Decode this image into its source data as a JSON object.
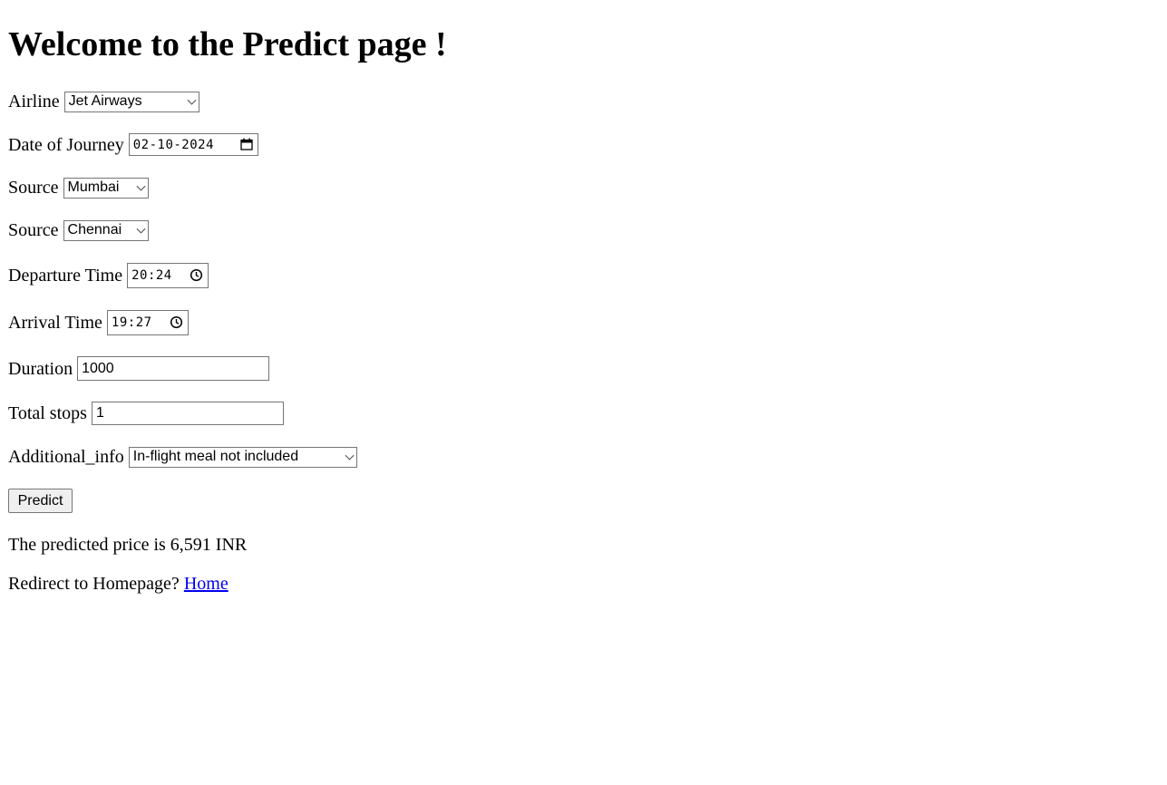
{
  "page": {
    "title": "Welcome to the Predict page !"
  },
  "form": {
    "airline": {
      "label": "Airline",
      "value": "Jet Airways"
    },
    "date_of_journey": {
      "label": "Date of Journey",
      "value": "02-10-2024"
    },
    "source": {
      "label": "Source",
      "value": "Mumbai"
    },
    "destination": {
      "label": "Source",
      "value": "Chennai"
    },
    "departure_time": {
      "label": "Departure Time",
      "value": "20:24"
    },
    "arrival_time": {
      "label": "Arrival Time",
      "value": "19:27"
    },
    "duration": {
      "label": "Duration",
      "value": "1000"
    },
    "total_stops": {
      "label": "Total stops",
      "value": "1"
    },
    "additional_info": {
      "label": "Additional_info",
      "value": "In-flight meal not included"
    },
    "submit_label": "Predict"
  },
  "result": {
    "text": "The predicted price is 6,591 INR"
  },
  "footer": {
    "redirect_text": "Redirect to Homepage?",
    "home_link": "Home"
  },
  "colors": {
    "link": "#0000ee",
    "button_bg": "#efefef",
    "control_border": "#767676"
  },
  "icons": [
    "calendar-icon",
    "clock-icon",
    "chevron-down-icon"
  ]
}
